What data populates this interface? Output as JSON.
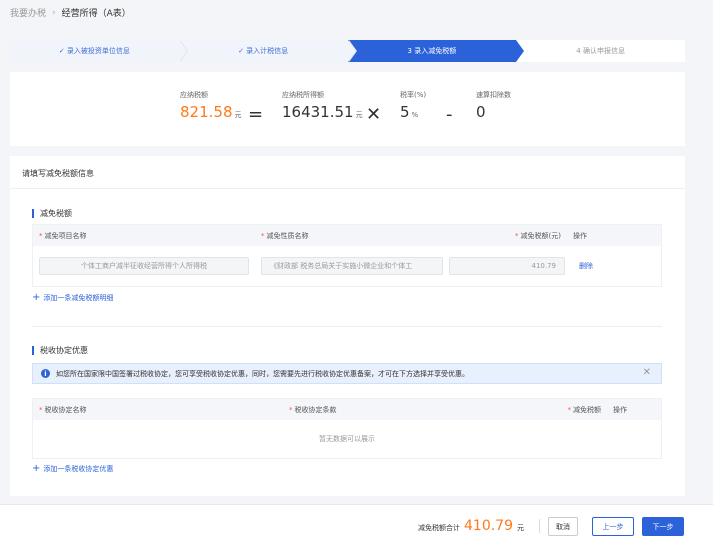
{
  "breadcrumb": {
    "root": "我要办税",
    "separator": "›",
    "current": "经营所得（A表）"
  },
  "steps": [
    {
      "label": "✓ 录入被投资单位信息",
      "state": "done"
    },
    {
      "label": "✓ 录入计税信息",
      "state": "done"
    },
    {
      "label": "3  录入减免税额",
      "state": "active"
    },
    {
      "label": "4  确认申报信息",
      "state": "todo"
    }
  ],
  "formula": {
    "tax_due_label": "应纳税额",
    "tax_due_value": "821.58",
    "unit_yuan": "元",
    "eq": "=",
    "taxable_income_label": "应纳税所得额",
    "taxable_income_value": "16431.51",
    "times": "✕",
    "rate_label": "税率(%)",
    "rate_value": "5",
    "rate_unit": "%",
    "minus": "-",
    "deduction_label": "速算扣除数",
    "deduction_value": "0"
  },
  "panel": {
    "title": "请填写减免税额信息",
    "relief": {
      "section_title": "减免税额",
      "columns": [
        "减免项目名称",
        "减免性质名称",
        "减免税额(元)",
        "操作"
      ],
      "row": {
        "item_name": "个体工商户减半征收经营所得个人所得税",
        "nature_name": "《财政部 税务总局关于实施小微企业和个体工",
        "amount": "410.79",
        "action": "删除"
      },
      "add_link": "添加一条减免税额明细"
    },
    "agreement": {
      "section_title": "税收协定优惠",
      "alert": "如您所在国家限中国签署过税收协定，您可享受税收协定优惠，同时，您需要先进行税收协定优惠备案，才可在下方选择并享受优惠。",
      "close": "✕",
      "columns": [
        "税收协定名称",
        "税收协定条款",
        "减免税额",
        "操作"
      ],
      "empty": "暂无数据可以展示",
      "add_link": "添加一条税收协定优惠"
    }
  },
  "footer": {
    "total_label": "减免税额合计",
    "total_value": "410.79",
    "unit": "元",
    "cancel": "取消",
    "prev": "上一步",
    "next": "下一步"
  },
  "required_mark": "*",
  "plus": "+"
}
